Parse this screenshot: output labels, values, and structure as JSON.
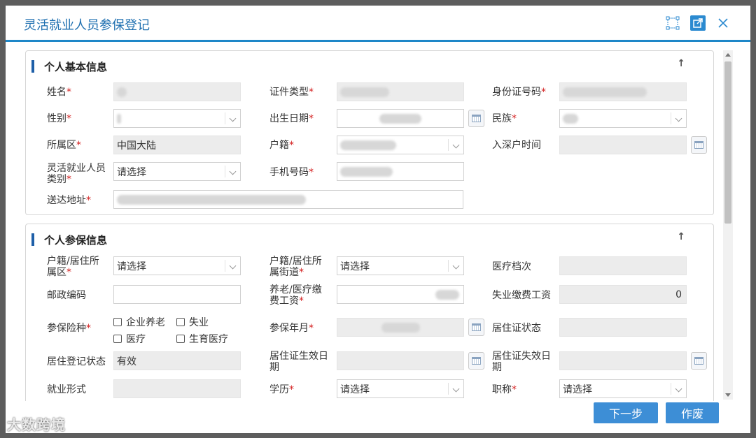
{
  "dialog": {
    "title": "灵活就业人员参保登记",
    "icons": [
      "resize-icon",
      "popout-icon",
      "close-icon"
    ]
  },
  "sections": {
    "basic": "个人基本信息",
    "insurance": "个人参保信息"
  },
  "basic": {
    "name_label": "姓名",
    "idtype_label": "证件类型",
    "idno_label": "身份证号码",
    "gender_label": "性别",
    "birth_label": "出生日期",
    "ethnic_label": "民族",
    "region_label": "所属区",
    "region_value": "中国大陆",
    "huji_label": "户籍",
    "entry_label": "入深户时间",
    "category_label_1": "灵活就业人员",
    "category_label_2": "类别",
    "category_value": "请选择",
    "phone_label": "手机号码",
    "address_label": "送达地址"
  },
  "insurance": {
    "district_label_1": "户籍/居住所",
    "district_label_2": "属区",
    "district_value": "请选择",
    "street_label_1": "户籍/居住所",
    "street_label_2": "属街道",
    "street_value": "请选择",
    "medical_label": "医疗档次",
    "postal_label": "邮政编码",
    "wage_label_1": "养老/医疗缴",
    "wage_label_2": "费工资",
    "unemp_wage_label": "失业缴费工资",
    "unemp_wage_value": "0",
    "types_label": "参保险种",
    "types": {
      "pension": "企业养老",
      "unemployment": "失业",
      "medical": "医疗",
      "maternity": "生育医疗"
    },
    "ym_label": "参保年月",
    "permit_status_label": "居住证状态",
    "reg_status_label": "居住登记状态",
    "reg_status_value": "有效",
    "permit_start_label_1": "居住证生效日",
    "permit_start_label_2": "期",
    "permit_end_label_1": "居住证失效日",
    "permit_end_label_2": "期",
    "employment_label": "就业形式",
    "education_label": "学历",
    "education_value": "请选择",
    "title_label": "职称",
    "title_value": "请选择"
  },
  "required_mark": "*",
  "buttons": {
    "next": "下一步",
    "void": "作废"
  },
  "watermark": "大数跨境"
}
